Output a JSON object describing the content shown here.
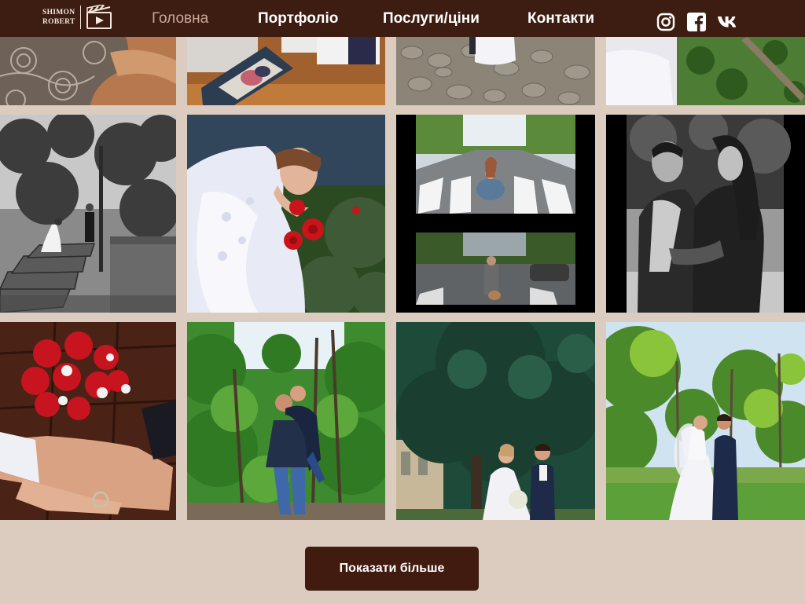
{
  "brand": {
    "logo_line1": "SHIMON",
    "logo_line2": "ROBERT"
  },
  "nav": {
    "items": [
      {
        "label": "Головна",
        "active": true
      },
      {
        "label": "Портфоліо",
        "active": false
      },
      {
        "label": "Послуги/ціни",
        "active": false
      },
      {
        "label": "Контакти",
        "active": false
      }
    ],
    "social": [
      "instagram-icon",
      "facebook-icon",
      "vk-icon"
    ]
  },
  "gallery": {
    "photos": [
      {
        "subject": "lace-fabric"
      },
      {
        "subject": "photo-album"
      },
      {
        "subject": "bride-on-cobblestones"
      },
      {
        "subject": "bride-by-pine"
      },
      {
        "subject": "couple-on-stone-stairs-bw"
      },
      {
        "subject": "bride-smelling-roses"
      },
      {
        "subject": "woman-on-crosswalk-collage"
      },
      {
        "subject": "couple-embracing-bw"
      },
      {
        "subject": "bouquet-and-rings"
      },
      {
        "subject": "couple-piggyback-forest"
      },
      {
        "subject": "couple-under-fir-tree"
      },
      {
        "subject": "couple-in-park"
      }
    ],
    "show_more_label": "Показати більше"
  },
  "colors": {
    "header_bg": "#3d1c12",
    "page_bg": "#dccbbf",
    "button_bg": "#411b10",
    "active_link": "#c9a89a"
  }
}
